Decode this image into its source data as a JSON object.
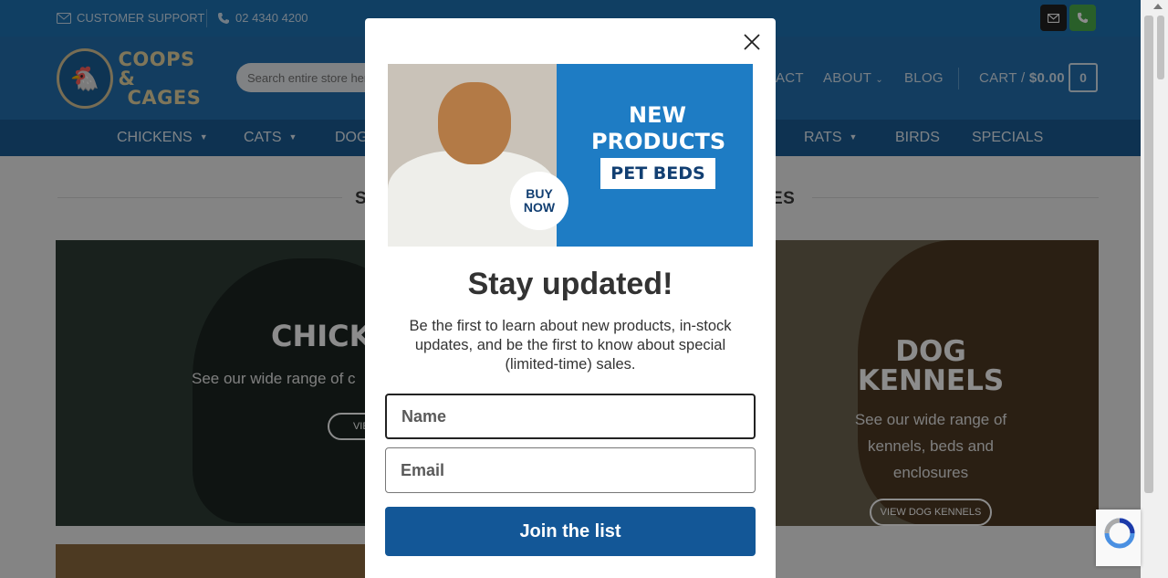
{
  "topbar": {
    "support_label": "CUSTOMER SUPPORT",
    "phone": "02 4340 4200",
    "email_icon": "envelope-icon",
    "phone_icon": "phone-icon"
  },
  "header": {
    "logo_line1": "COOPS &",
    "logo_line2": "CAGES",
    "search_placeholder": "Search entire store here...",
    "nav_contact": "ACT",
    "nav_about": "ABOUT",
    "nav_blog": "BLOG",
    "cart_label": "CART /",
    "cart_total": "$0.00",
    "cart_count": "0"
  },
  "categories": {
    "chickens": "CHICKENS",
    "cats": "CATS",
    "dogs": "DOG",
    "rats": "RATS",
    "birds": "BIRDS",
    "specials": "SPECIALS"
  },
  "content": {
    "section_left": "S",
    "section_right": "ES",
    "tile_left_title": "CHICK",
    "tile_left_sub": "See our wide range of c",
    "tile_left_btn": "VIEW",
    "tile_right_title_1": "DOG",
    "tile_right_title_2": "KENNELS",
    "tile_right_sub_1": "See our wide range of",
    "tile_right_sub_2": "kennels, beds and",
    "tile_right_sub_3": "enclosures",
    "tile_right_btn": "VIEW DOG KENNELS"
  },
  "modal": {
    "banner_buy_1": "BUY",
    "banner_buy_2": "NOW",
    "banner_new_1": "NEW",
    "banner_new_2": "PRODUCTS",
    "banner_pet_beds": "PET BEDS",
    "title": "Stay updated!",
    "description": "Be the first to learn about new products, in-stock updates, and be the first to know about special (limited-time) sales.",
    "name_placeholder": "Name",
    "email_placeholder": "Email",
    "submit_label": "Join the list"
  },
  "colors": {
    "topbar": "#1e73b4",
    "header": "#236fb0",
    "catnav": "#1a5c94",
    "button": "#135797"
  }
}
